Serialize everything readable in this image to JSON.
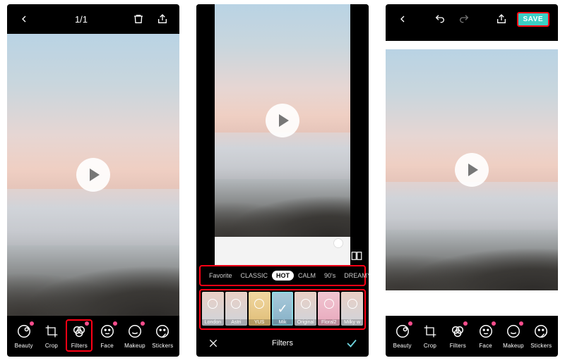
{
  "screen1": {
    "counter": "1/1",
    "tools": [
      {
        "id": "beauty",
        "label": "Beauty",
        "dot": true
      },
      {
        "id": "crop",
        "label": "Crop",
        "dot": false
      },
      {
        "id": "filters",
        "label": "Filters",
        "dot": true
      },
      {
        "id": "face",
        "label": "Face",
        "dot": true
      },
      {
        "id": "makeup",
        "label": "Makeup",
        "dot": true
      },
      {
        "id": "stickers",
        "label": "Stickers",
        "dot": false
      }
    ]
  },
  "screen2": {
    "categories": [
      {
        "id": "favorite",
        "label": "Favorite",
        "active": false
      },
      {
        "id": "classic",
        "label": "CLASSIC",
        "active": false
      },
      {
        "id": "hot",
        "label": "HOT",
        "active": true
      },
      {
        "id": "calm",
        "label": "CALM",
        "active": false
      },
      {
        "id": "90s",
        "label": "90's",
        "active": false
      },
      {
        "id": "dreamy",
        "label": "DREAMY",
        "active": false
      }
    ],
    "thumbs": [
      {
        "id": "london",
        "label": "London"
      },
      {
        "id": "astri",
        "label": "Astri"
      },
      {
        "id": "yus",
        "label": "YUS"
      },
      {
        "id": "mik",
        "label": "Mik"
      },
      {
        "id": "original",
        "label": "Original"
      },
      {
        "id": "floral2",
        "label": "Floral2"
      },
      {
        "id": "milky",
        "label": "Milky w"
      }
    ],
    "panel_title": "Filters"
  },
  "screen3": {
    "save_label": "SAVE",
    "tools": [
      {
        "id": "beauty",
        "label": "Beauty",
        "dot": true
      },
      {
        "id": "crop",
        "label": "Crop",
        "dot": false
      },
      {
        "id": "filters",
        "label": "Filters",
        "dot": true
      },
      {
        "id": "face",
        "label": "Face",
        "dot": true
      },
      {
        "id": "makeup",
        "label": "Makeup",
        "dot": true
      },
      {
        "id": "stickers",
        "label": "Stickers",
        "dot": false
      }
    ]
  },
  "icon_labels": {
    "back": "back",
    "delete": "delete",
    "share": "share",
    "undo": "undo",
    "redo": "redo",
    "compare": "compare",
    "close": "close",
    "confirm": "confirm",
    "play": "play"
  }
}
